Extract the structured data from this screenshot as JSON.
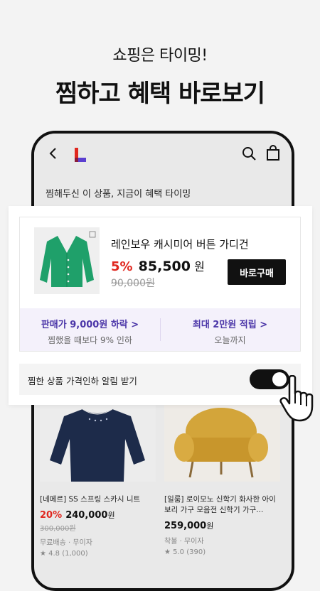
{
  "headline": {
    "subtitle": "쇼핑은 타이밍!",
    "title": "찜하고 혜택 바로보기"
  },
  "app": {
    "section_title": "찜해두신 이 상품, 지금이 혜택 타이밍"
  },
  "popup": {
    "product_name": "레인보우 캐시미어 버튼 가디건",
    "discount": "5%",
    "price": "85,500",
    "won": "원",
    "original_price": "90,000원",
    "buy_label": "바로구매",
    "benefit_left_title": "판매가 9,000원 하락 >",
    "benefit_left_sub": "찜했을 때보다 9% 인하",
    "benefit_right_title": "최대 2만원 적립 >",
    "benefit_right_sub": "오늘까지",
    "alert_label": "찜한 상품 가격인하 알림 받기",
    "alert_on": true
  },
  "products": [
    {
      "name": "[네메르] SS 스프링 스카시 니트",
      "discount": "20%",
      "price": "240,000",
      "won": "원",
      "original_price": "300,000원",
      "shipping": "무료배송 · 무이자",
      "rating": "★ 4.8 (1,000)"
    },
    {
      "name": "[일룸] 로이모노 신학기 화사한 아이보리 가구 모음전 신학기 가구...",
      "discount": "",
      "price": "259,000",
      "won": "원",
      "original_price": "",
      "shipping": "착불 · 무이자",
      "rating": "★ 5.0 (390)"
    }
  ],
  "colors": {
    "accent_red": "#e0271f",
    "benefit_purple": "#4b36a8",
    "logo_red": "#e0271f",
    "logo_purple": "#5b3fd0"
  }
}
